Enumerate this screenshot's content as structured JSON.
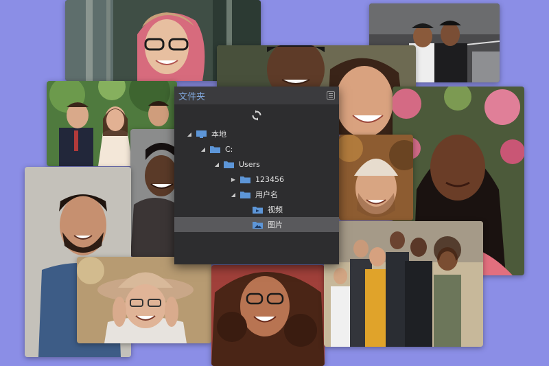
{
  "colors": {
    "background": "#8b8ee6",
    "panel": "#2d2d2f",
    "panel_header": "#3b3b3e",
    "title": "#7fa4d8",
    "selected_row": "#59595c",
    "folder_blue": "#5d96d8"
  },
  "panel": {
    "title": "文件夹",
    "menu_icon": "menu-icon",
    "refresh_icon": "refresh-icon",
    "tree": [
      {
        "label": "本地",
        "icon": "monitor-icon",
        "state": "expanded"
      },
      {
        "label": "C:",
        "icon": "folder-icon",
        "state": "expanded"
      },
      {
        "label": "Users",
        "icon": "folder-icon",
        "state": "expanded"
      },
      {
        "label": "123456",
        "icon": "folder-icon",
        "state": "collapsed"
      },
      {
        "label": "用户名",
        "icon": "folder-icon",
        "state": "expanded"
      },
      {
        "label": "视频",
        "icon": "video-folder-icon",
        "state": "leaf"
      },
      {
        "label": "图片",
        "icon": "image-folder-icon",
        "state": "leaf",
        "selected": true
      }
    ]
  },
  "photos": [
    {
      "name": "photo-woman-glasses-pink-hair"
    },
    {
      "name": "photo-two-women-hugging"
    },
    {
      "name": "photo-man-and-woman-laughing"
    },
    {
      "name": "photo-wedding-party"
    },
    {
      "name": "photo-woman-flowers"
    },
    {
      "name": "photo-young-man-laughing"
    },
    {
      "name": "photo-man-beanie"
    },
    {
      "name": "photo-bearded-man-smiling"
    },
    {
      "name": "photo-older-woman-hat"
    },
    {
      "name": "photo-woman-curly-hair-glasses"
    },
    {
      "name": "photo-group-of-friends"
    }
  ]
}
